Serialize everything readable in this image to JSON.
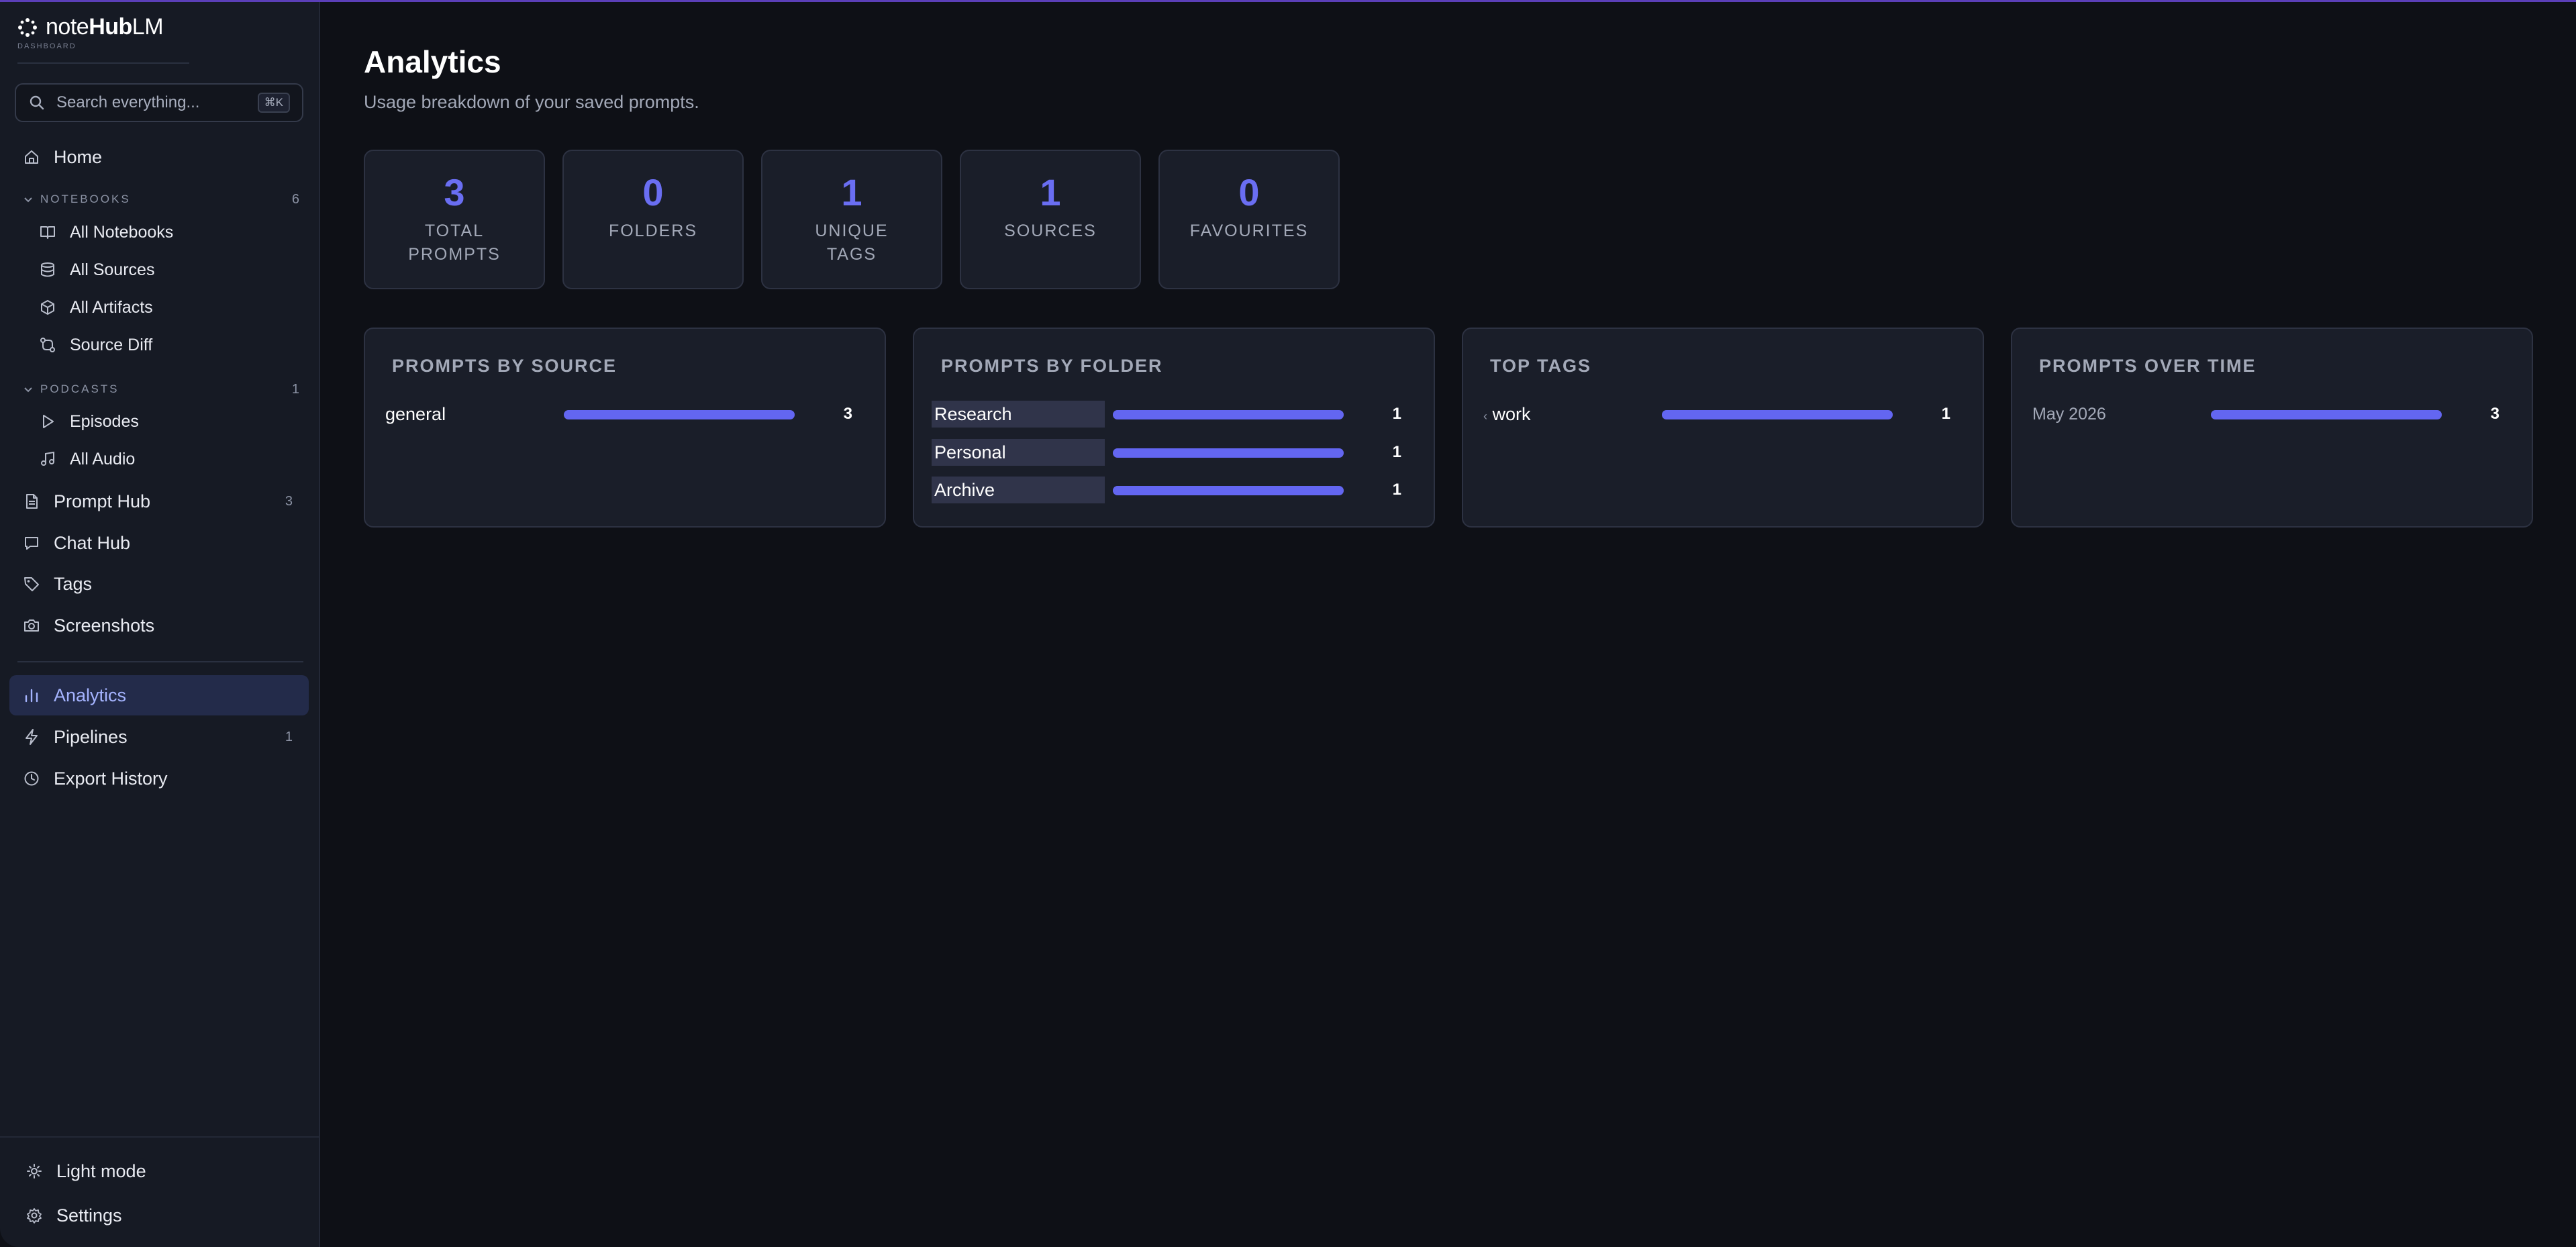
{
  "app": {
    "logo_prefix": "note",
    "logo_bold": "Hub",
    "logo_suffix": "LM",
    "logo_sub": "DASHBOARD"
  },
  "search": {
    "placeholder": "Search everything...",
    "shortcut": "⌘K"
  },
  "sidebar": {
    "home": "Home",
    "notebooks_section": {
      "label": "NOTEBOOKS",
      "count": "6"
    },
    "notebooks": [
      {
        "label": "All Notebooks",
        "icon": "book-icon"
      },
      {
        "label": "All Sources",
        "icon": "database-icon"
      },
      {
        "label": "All Artifacts",
        "icon": "cube-icon"
      },
      {
        "label": "Source Diff",
        "icon": "diff-icon"
      }
    ],
    "podcasts_section": {
      "label": "PODCASTS",
      "count": "1"
    },
    "podcasts": [
      {
        "label": "Episodes",
        "icon": "play-icon"
      },
      {
        "label": "All Audio",
        "icon": "music-icon"
      }
    ],
    "prompt_hub": {
      "label": "Prompt Hub",
      "count": "3"
    },
    "chat_hub": "Chat Hub",
    "tags": "Tags",
    "screenshots": "Screenshots",
    "analytics": "Analytics",
    "pipelines": {
      "label": "Pipelines",
      "count": "1"
    },
    "export_history": "Export History",
    "light_mode": "Light mode",
    "settings": "Settings"
  },
  "page": {
    "title": "Analytics",
    "subtitle": "Usage breakdown of your saved prompts."
  },
  "stats": [
    {
      "value": "3",
      "label": "TOTAL PROMPTS"
    },
    {
      "value": "0",
      "label": "FOLDERS"
    },
    {
      "value": "1",
      "label": "UNIQUE TAGS"
    },
    {
      "value": "1",
      "label": "SOURCES"
    },
    {
      "value": "0",
      "label": "FAVOURITES"
    }
  ],
  "cards": {
    "by_source": {
      "title": "PROMPTS BY SOURCE",
      "rows": [
        {
          "label": "general",
          "value": "3",
          "fraction": 1.0
        }
      ]
    },
    "by_folder": {
      "title": "PROMPTS BY FOLDER",
      "rows": [
        {
          "label": "Research",
          "value": "1",
          "fraction": 1.0
        },
        {
          "label": "Personal",
          "value": "1",
          "fraction": 1.0
        },
        {
          "label": "Archive",
          "value": "1",
          "fraction": 1.0
        }
      ]
    },
    "top_tags": {
      "title": "TOP TAGS",
      "rows": [
        {
          "label": "work",
          "value": "1",
          "fraction": 1.0
        }
      ]
    },
    "over_time": {
      "title": "PROMPTS OVER TIME",
      "rows": [
        {
          "label": "May 2026",
          "value": "3",
          "fraction": 1.0
        }
      ]
    }
  },
  "colors": {
    "accent": "#6366f1",
    "active_bg": "#232b4a",
    "active_text": "#a5b4ff",
    "top_border": "#5b3fb8"
  }
}
